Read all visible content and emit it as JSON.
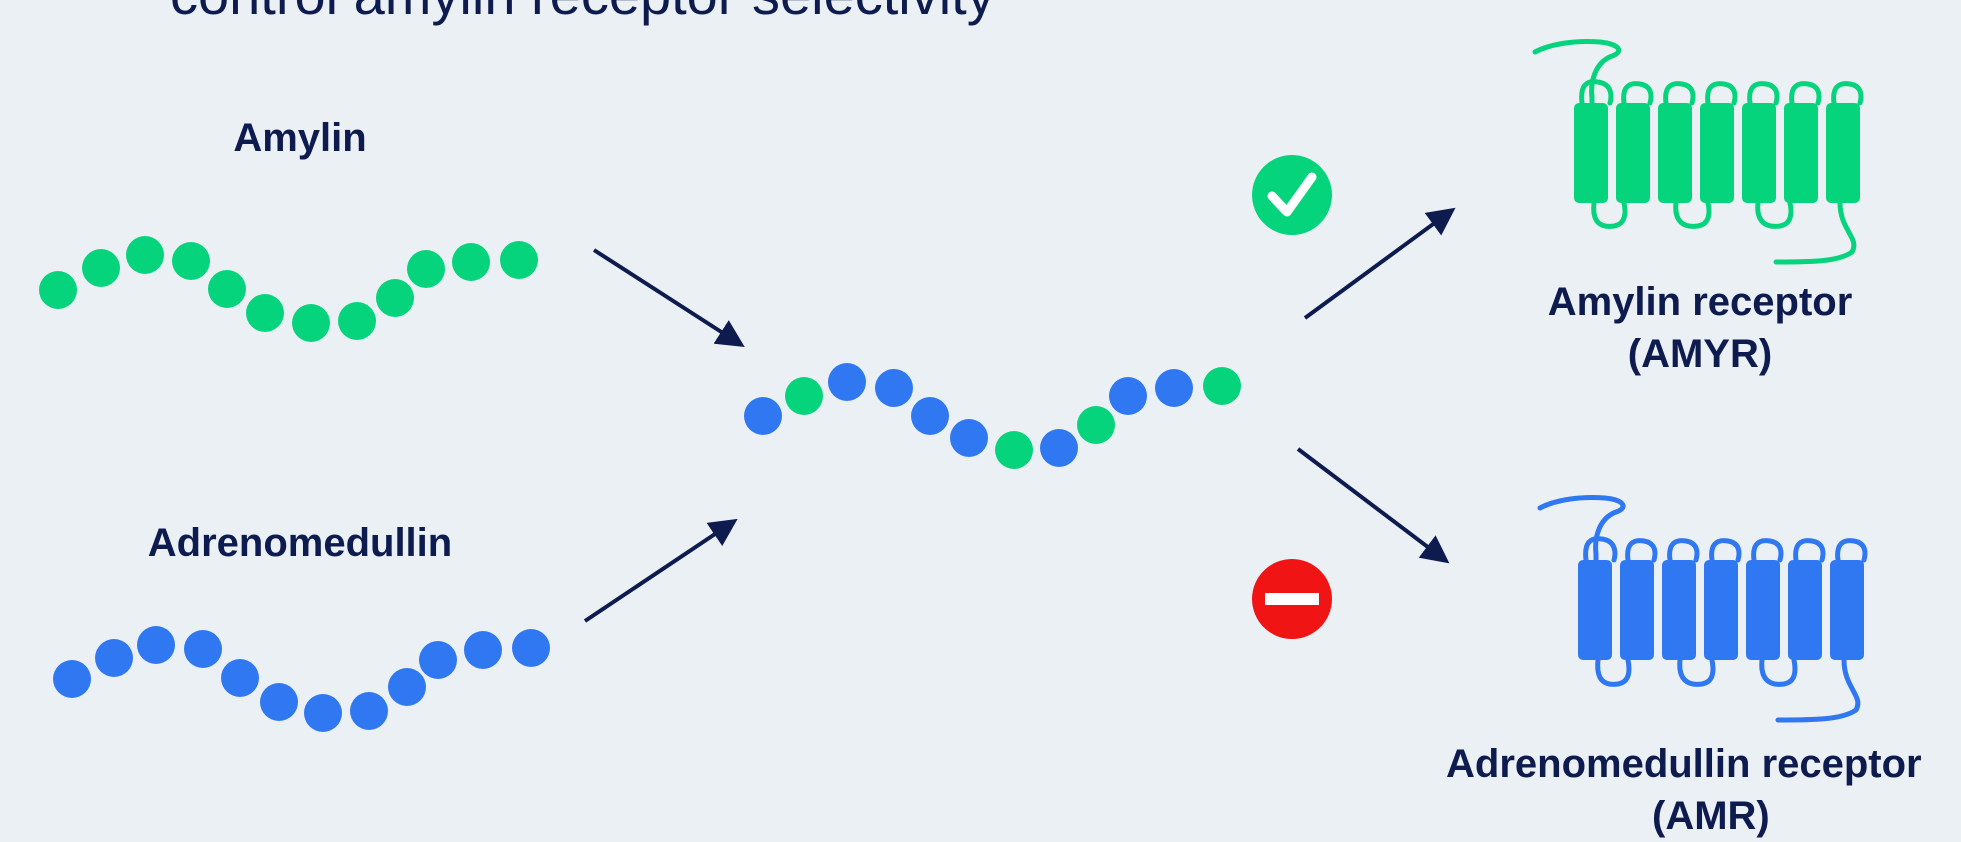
{
  "title": "control amylin receptor selectivity",
  "labels": {
    "amylin": "Amylin",
    "adrenomedullin": "Adrenomedullin",
    "amylin_receptor_line1": "Amylin receptor",
    "amylin_receptor_line2": "(AMYR)",
    "adm_receptor_line1": "Adrenomedullin receptor",
    "adm_receptor_line2": "(AMR)"
  },
  "colors": {
    "amylin_green": "#06d47c",
    "adm_blue": "#2f78f2",
    "navy": "#0d1b4f",
    "block_red": "#f01414",
    "background": "#ebf0f5"
  },
  "icons": {
    "allowed": "check-circle-icon",
    "blocked": "no-entry-icon"
  },
  "hybrid_sequence": [
    "blue",
    "green",
    "blue",
    "blue",
    "blue",
    "blue",
    "green",
    "blue",
    "green",
    "blue",
    "blue",
    "green"
  ]
}
